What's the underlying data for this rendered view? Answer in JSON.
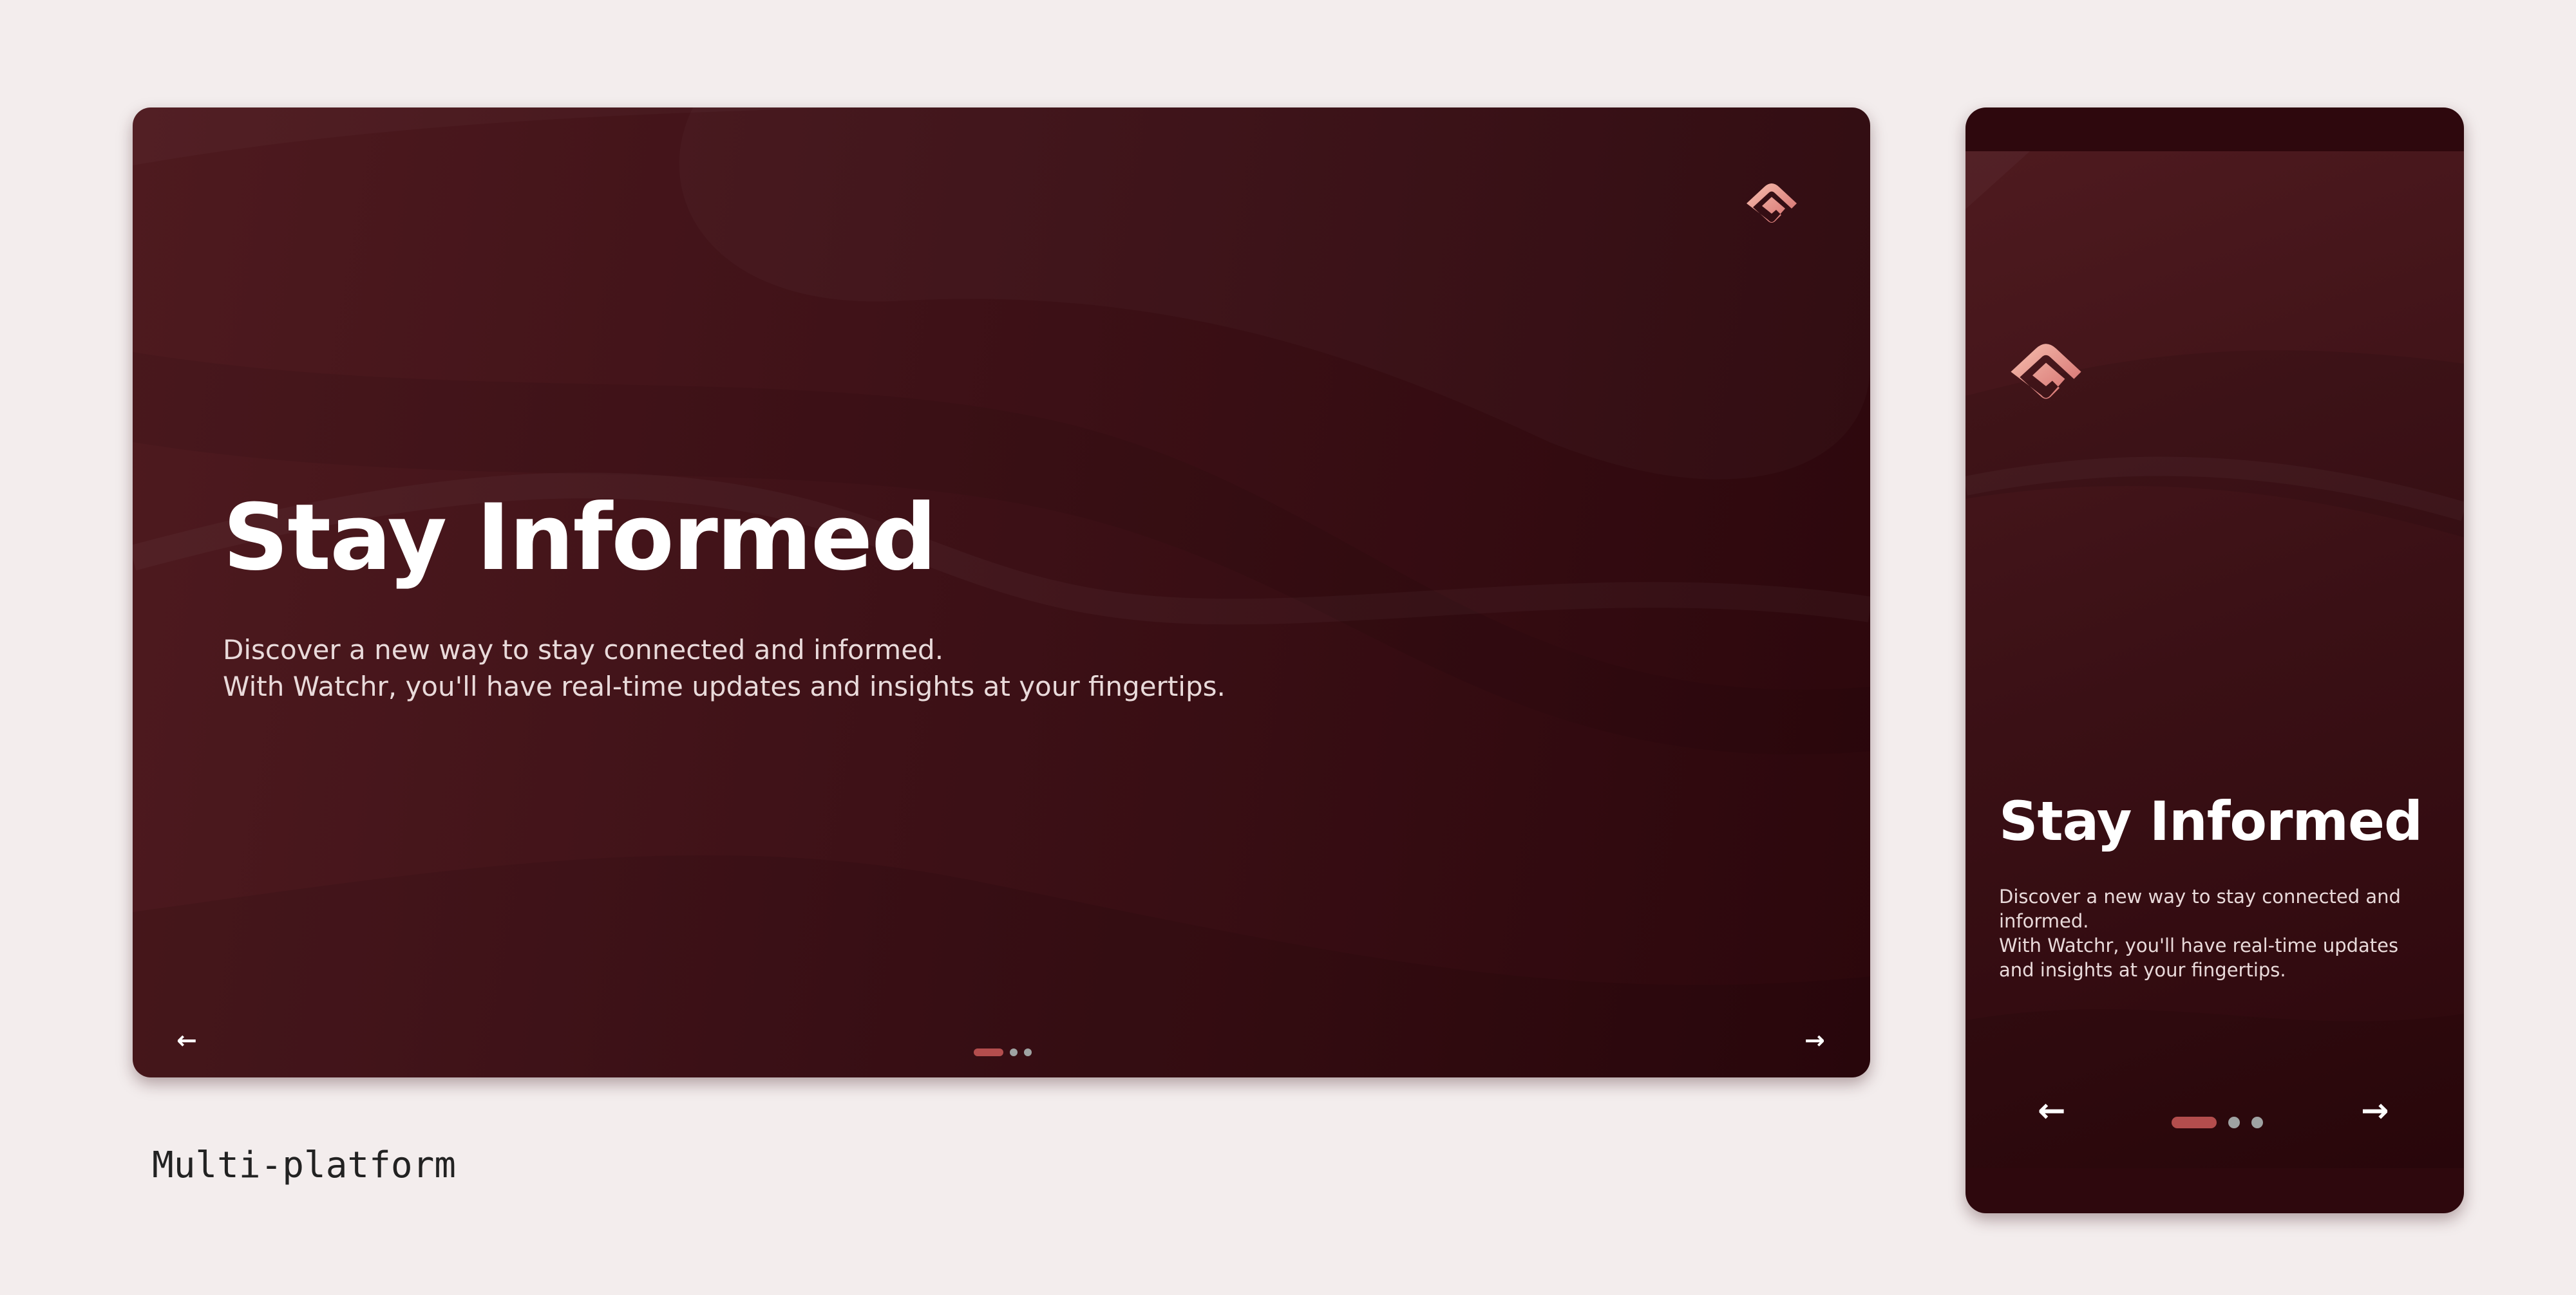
{
  "colors": {
    "page_background": "#f3eded",
    "card_dark": "#2c070c",
    "card_light": "#4e1a1f",
    "accent": "#b34d4d",
    "dot_inactive": "#9fa3a3",
    "title_text": "#ffffff",
    "body_text": "#e9dada"
  },
  "desktop": {
    "logo_icon": "watchr-eye-logo-icon",
    "title": "Stay Informed",
    "description_lines": [
      "Discover a new way to stay connected and informed.",
      "With Watchr, you'll have real-time updates and insights at your fingertips."
    ],
    "prev_icon": "←",
    "next_icon": "→",
    "carousel": {
      "total_slides": 3,
      "active_index": 0
    }
  },
  "mobile": {
    "logo_icon": "watchr-eye-logo-icon",
    "title": "Stay Informed",
    "description_lines": [
      "Discover a new way to stay connected and informed.",
      "With Watchr, you'll have real-time updates and insights at your fingertips."
    ],
    "prev_icon": "←",
    "next_icon": "→",
    "carousel": {
      "total_slides": 3,
      "active_index": 0
    }
  },
  "caption": "Multi-platform"
}
